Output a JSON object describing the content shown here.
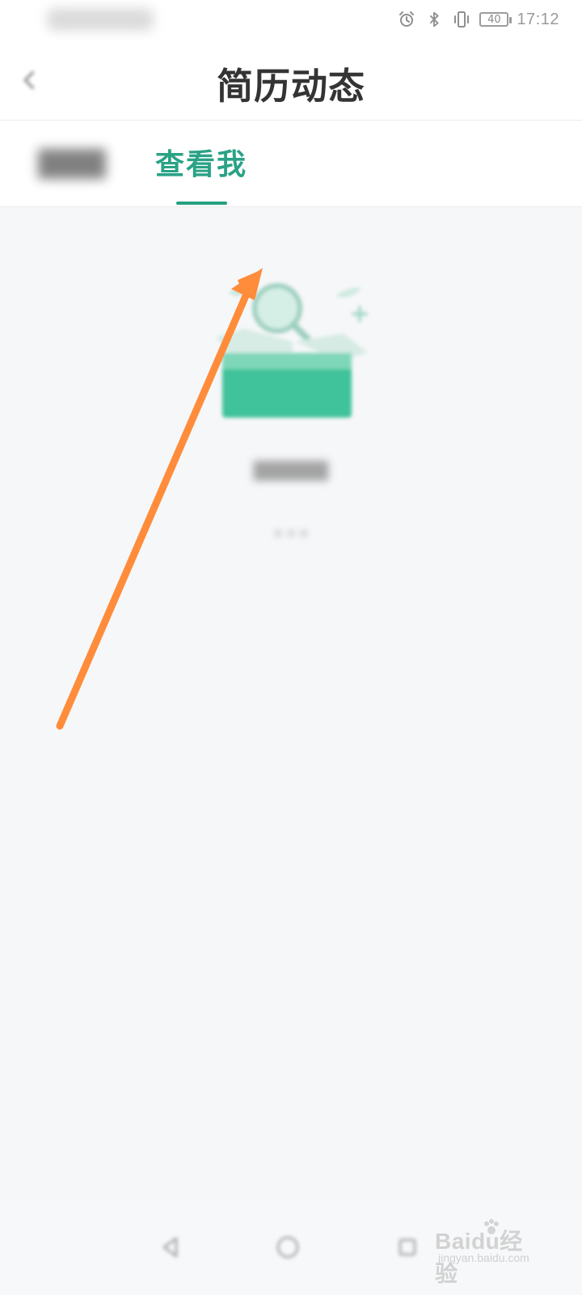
{
  "status_bar": {
    "battery_level": "40",
    "time": "17:12",
    "icons": [
      "alarm-icon",
      "bluetooth-icon",
      "vibrate-icon",
      "battery-icon"
    ]
  },
  "header": {
    "title": "简历动态"
  },
  "tabs": [
    {
      "label": ""
    },
    {
      "label": "查看我"
    }
  ],
  "empty_state": {
    "illustration": "empty-box-search"
  },
  "watermark": {
    "brand": "Baidu经验",
    "site": "jingyan.baidu.com"
  },
  "colors": {
    "accent": "#26A182",
    "accent_light": "#3EC39D",
    "annotation_arrow": "#FF8C3A",
    "background": "#F6F7F9"
  }
}
